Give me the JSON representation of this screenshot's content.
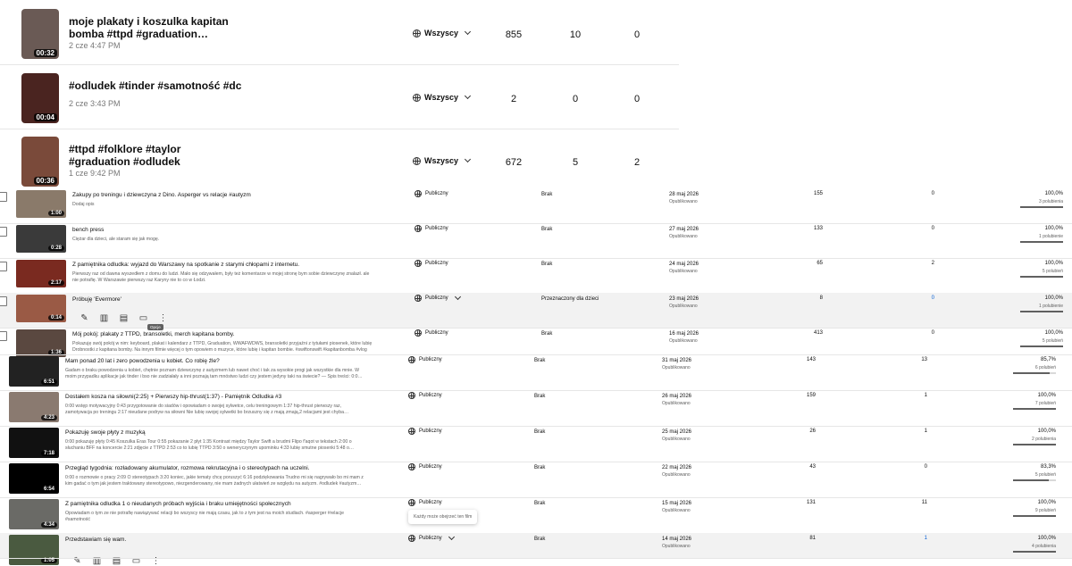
{
  "top_rows": [
    {
      "title_line1": "moje plakaty i koszulka kapitan",
      "title_line2": "bomba #ttpd #graduation…",
      "date": "2 cze 4:47 PM",
      "duration": "00:32",
      "visibility": "Wszyscy",
      "views": "855",
      "comments": "10",
      "likes": "0"
    },
    {
      "title_line1": "#odludek #tinder #samotność #dc",
      "title_line2": "",
      "date": "2 cze 3:43 PM",
      "duration": "00:04",
      "visibility": "Wszyscy",
      "views": "2",
      "comments": "0",
      "likes": "0"
    },
    {
      "title_line1": "#ttpd #folklore #taylor",
      "title_line2": "#graduation #odludek",
      "date": "1 cze 9:42 PM",
      "duration": "00:36",
      "visibility": "Wszyscy",
      "views": "672",
      "comments": "5",
      "likes": "2"
    }
  ],
  "mid_rows": [
    {
      "title": "Zakupy po treningu i dziewczyna z Dino. Asperger vs relacje #autyzm",
      "desc1": "Dodaj opis",
      "desc2": "",
      "duration": "1:00",
      "visibility": "Publiczny",
      "restriction": "Brak",
      "date": "28 maj 2026",
      "status": "Opublikowano",
      "views": "155",
      "comments": "0",
      "pct": "100,0%",
      "likes_text": "3 polubienia",
      "ratio": 1.0
    },
    {
      "title": "bench press",
      "desc1": "Ciężar dla dzieci, ale staram się jak mogę.",
      "desc2": "",
      "duration": "0:28",
      "visibility": "Publiczny",
      "restriction": "Brak",
      "date": "27 maj 2026",
      "status": "Opublikowano",
      "views": "133",
      "comments": "0",
      "pct": "100,0%",
      "likes_text": "1 polubienie",
      "ratio": 1.0
    },
    {
      "title": "Z pamiętnika odludka: wyjazd do Warszawy na spotkanie z starymi chłopami z internetu.",
      "desc1": "Pierwszy raz od dawna wyszedłem z domu do ludzi. Mało się odzywałem, były też komentarze w mojej stronę bym sobie dziewczynę znalazł. ale",
      "desc2": "nie potrafię. W Warszawie pierwszy raz Karyny nie to co w Łodzi.",
      "duration": "2:17",
      "visibility": "Publiczny",
      "restriction": "Brak",
      "date": "24 maj 2026",
      "status": "Opublikowano",
      "views": "65",
      "comments": "2",
      "pct": "100,0%",
      "likes_text": "5 polubień",
      "ratio": 1.0
    },
    {
      "title": "Próbuję 'Evermore'",
      "desc1": "",
      "desc2": "",
      "duration": "0:14",
      "visibility": "Publiczny",
      "restriction": "Przeznaczony dla dzieci",
      "date": "23 maj 2026",
      "status": "Opublikowano",
      "views": "8",
      "comments": "0",
      "pct": "100,0%",
      "likes_text": "1 polubienie",
      "ratio": 1.0,
      "hover": true,
      "tooltip": "Opcje"
    },
    {
      "title": "Mój pokój: plakaty z TTPD, bransoletki, merch kapitana bomby.",
      "desc1": "Pokazuję swój pokój w nim: keyboard, plakat i kalendarz z TTPD, Graduation, WWAFWDWS, bransoletki przyjaźni z tytułami piosenek, które lubię",
      "desc2": "Drobnostki z kapitana bomby. Na innym filmie więcej o tym opowiem o muzyce, które lubię i kapitan bombie. #swiftonswift #kapitanbomba #vlog",
      "duration": "1:36",
      "visibility": "Publiczny",
      "restriction": "Brak",
      "date": "16 maj 2026",
      "status": "Opublikowano",
      "views": "413",
      "comments": "0",
      "pct": "100,0%",
      "likes_text": "5 polubień",
      "ratio": 1.0
    }
  ],
  "bottom_rows": [
    {
      "title": "Mam ponad 20 lat i zero powodzenia u kobiet. Co robię źle?",
      "desc1": "Gadam o braku powodzenia u kobiet, chętnie poznam dziewczynę z autyzmem lub nawet choć i tak za wysokie progi jak wszystkie dla mnie. W",
      "desc2": "moim przypadku aplikacje jak tinder i bso nie zadziałały a inni poznają tam mnóstwo ludzi czy jestem jedyny taki na świecie? — Spis treści: 0:0…",
      "duration": "6:51",
      "visibility": "Publiczny",
      "restriction": "Brak",
      "date": "31 maj 2026",
      "status": "Opublikowano",
      "views": "143",
      "comments": "13",
      "pct": "85,7%",
      "likes_text": "6 polubień",
      "ratio": 0.857
    },
    {
      "title": "Dostałem kosza na siłowni(2:25) + Pierwszy hip-thrust(1:37) - Pamiętnik Odludka #3",
      "desc1": "0:00 wstęp motywacyjny 0:43 przygotowanie do siadów i opowiadam o swojej sylwetce, celu treningowym 1:37 hip-thrust pierwszy raz,",
      "desc2": "zamotywacja po treningu 2:17 nieudane podryw na siłowni Nie lubię swojej sylwetki bo brzuszny się z mają zmają,2 relacjami jest chyba…",
      "duration": "4:23",
      "visibility": "Publiczny",
      "restriction": "Brak",
      "date": "26 maj 2026",
      "status": "Opublikowano",
      "views": "159",
      "comments": "1",
      "pct": "100,0%",
      "likes_text": "7 polubień",
      "ratio": 1.0
    },
    {
      "title": "Pokazuję swoje płyty z muzyką",
      "desc1": "0:00 pokazuję płyty 0:45 Koszulka Eras Tour 0:55 pokazanie 2 płyt 1:35 Kontrast między Taylor Swift a brudmi Flipo f'aqot w tekstach 2:00 o",
      "desc2": "słuchaniu BFF na koncercie 2:21 zdjęcie z TTPD 2:53 co to lubię TTPD 3:50 o weneryczynym upominku 4:33 lubię smutne piosenki 5:48 o…",
      "duration": "7:18",
      "visibility": "Publiczny",
      "restriction": "Brak",
      "date": "25 maj 2026",
      "status": "Opublikowano",
      "views": "26",
      "comments": "1",
      "pct": "100,0%",
      "likes_text": "2 polubienia",
      "ratio": 1.0
    },
    {
      "title": "Przegląd tygodnia: rozładowany akumulator, rozmowa rekrutacyjna i o stereotypach na uczelni.",
      "desc1": "0:00 o rozmowie o pracy 2:09 O stereotypach 3:20 koniec, jakie tematy chcę poruszyć 6:16 podziękowania Trudno mi się nagrywało bo mi mam z",
      "desc2": "kim gadać o tym jak jestem traktowany stereotypowo, niezgenderowany, nie mam żadnych ułatwień ze względu na autyzm. #odludek #autyzm…",
      "duration": "6:54",
      "visibility": "Publiczny",
      "restriction": "Brak",
      "date": "22 maj 2026",
      "status": "Opublikowano",
      "views": "43",
      "comments": "0",
      "pct": "83,3%",
      "likes_text": "5 polubień",
      "ratio": 0.833
    },
    {
      "title": "Z pamiętnika odludka 1 o nieudanych próbach wyjścia i braku umiejętności społecznych",
      "desc1": "Opowiadam o tym ze nie potrafię nawiązywać relacji bo wszyscy nie mają czasu, jak to z tym jest na moich studiach. #asperger #relacje",
      "desc2": "#samotność",
      "duration": "4:34",
      "visibility": "Publiczny",
      "restriction": "Brak",
      "date": "15 maj 2026",
      "status": "Opublikowano",
      "views": "131",
      "comments": "11",
      "pct": "100,0%",
      "likes_text": "9 polubień",
      "ratio": 1.0,
      "tooltip": "Każdy może obejrzeć ten film"
    },
    {
      "title": "Przedstawiam się wam.",
      "desc1": "",
      "desc2": "",
      "duration": "1:05",
      "visibility": "Publiczny",
      "restriction": "Brak",
      "date": "14 maj 2026",
      "status": "Opublikowano",
      "views": "81",
      "comments": "1",
      "pct": "100,0%",
      "likes_text": "4 polubienia",
      "ratio": 1.0,
      "hover": true
    }
  ]
}
